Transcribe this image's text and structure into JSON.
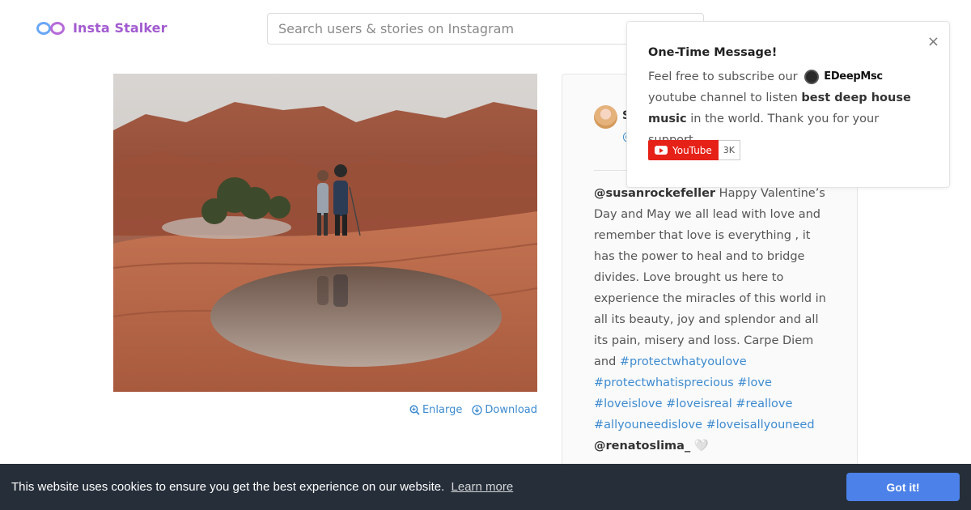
{
  "header": {
    "logo_text": "Insta Stalker",
    "search_placeholder": "Search users & stories on Instagram"
  },
  "photo": {
    "enlarge_label": "Enlarge",
    "download_label": "Download"
  },
  "post": {
    "owner_initial": "S",
    "owner_at": "@",
    "caption_user": "@susanrockefeller",
    "caption_text": " Happy Valentine’s Day and May we all lead with love and remember that love is everything , it has the power to heal and to bridge divides. Love brought us here to experience the miracles of this world in all its beauty, joy and splendor and all its pain, misery and loss. Carpe Diem and ",
    "hashtags": [
      "#protectwhatyoulove",
      "#protectwhatisprecious",
      "#love",
      "#loveislove",
      "#loveisreal",
      "#reallove",
      "#allyouneedislove",
      "#loveisallyouneed"
    ],
    "comment_user": "@renatoslima_",
    "comment_text": " 🤍"
  },
  "popup": {
    "title": "One-Time Message!",
    "line_prefix": "Feel free to subscribe our",
    "channel_name": "EDeepMsc",
    "line_suffix": "youtube channel to listen",
    "bold_text": "best deep house music",
    "line_end": "in the world. Thank you for your support.",
    "youtube_label": "YouTube",
    "subscriber_count": "3K",
    "close_label": "×"
  },
  "cookie": {
    "message": "This website uses cookies to ensure you get the best experience on our website.",
    "learn_more": "Learn more",
    "accept": "Got it!"
  },
  "colors": {
    "accent_purple": "#a25bd0",
    "link_blue": "#3d8bd0",
    "cookie_bg": "#252e39",
    "cookie_button": "#4b81e8",
    "youtube_red": "#e62117"
  }
}
